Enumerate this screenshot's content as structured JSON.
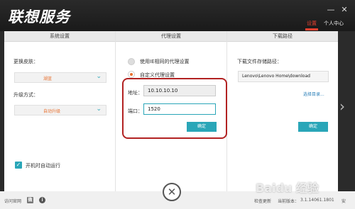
{
  "app": {
    "title": "联想服务"
  },
  "window_controls": {
    "minimize": "—",
    "close": "✕"
  },
  "top_tabs": [
    {
      "label": "设置",
      "active": true
    },
    {
      "label": "个人中心",
      "active": false
    }
  ],
  "columns": {
    "system": {
      "header": "系统设置",
      "skin_label": "更换皮肤：",
      "skin_value": "湖蓝",
      "upgrade_label": "升级方式：",
      "upgrade_value": "自动升级",
      "autostart_label": "开机时自动运行",
      "autostart_checked": true
    },
    "proxy": {
      "header": "代理设置",
      "option_ie": "使用IE相同的代理设置",
      "option_custom": "自定义代理设置",
      "selected": "custom",
      "address_label": "地址：",
      "address_value": "10.10.10.10",
      "port_label": "端口：",
      "port_value": "1520",
      "confirm": "确定"
    },
    "download": {
      "header": "下载路径",
      "path_label": "下载文件存储路径：",
      "path_value": "Lenovo\\Lenovo Home\\download",
      "choose_dir": "选择目录...",
      "confirm": "确定"
    }
  },
  "footer": {
    "official_site": "访问官网",
    "check_update": "检查更新",
    "version_label": "当前版本：",
    "version_value": "3.1.14061.1801",
    "tail": "安"
  },
  "watermark": "Baidu 经验",
  "colors": {
    "accent_teal": "#2aa6b8",
    "accent_red": "#e8402f",
    "highlight": "#b22222"
  }
}
